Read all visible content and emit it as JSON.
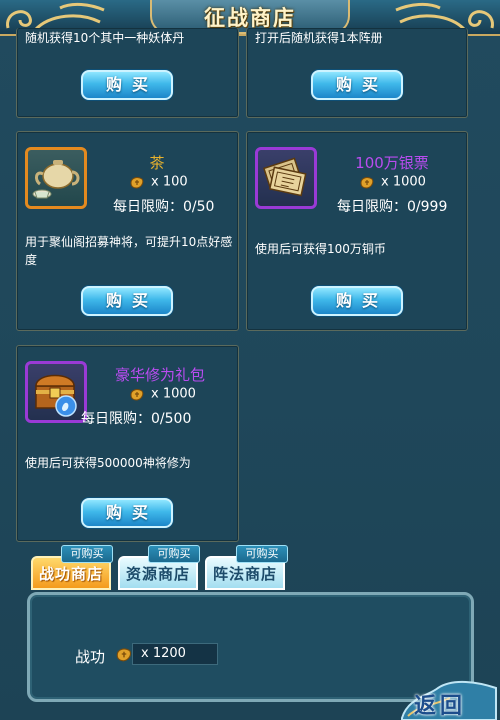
{
  "title": "征战商店",
  "top_cards": [
    {
      "desc_partial": "随机获得10个其中一种妖体丹",
      "buy_label": "购买"
    },
    {
      "desc_partial": "打开后随机获得1本阵册",
      "buy_label": "购买"
    }
  ],
  "items": [
    {
      "name": "茶",
      "name_color": "#e8b22d",
      "price": "x 100",
      "limit": "每日限购：0/50",
      "desc": "用于聚仙阁招募神将，可提升10点好感度",
      "buy_label": "购买",
      "icon": "teapot-icon"
    },
    {
      "name": "100万银票",
      "name_color": "#b94cf0",
      "price": "x 1000",
      "limit": "每日限购：0/999",
      "desc": "使用后可获得100万铜币",
      "buy_label": "购买",
      "icon": "banknote-icon"
    },
    {
      "name": "豪华修为礼包",
      "name_color": "#b94cf0",
      "price": "x 1000",
      "limit": "每日限购：0/500",
      "desc": "使用后可获得500000神将修为",
      "buy_label": "购买",
      "icon": "treasure-chest-icon"
    }
  ],
  "tabs": [
    {
      "label": "战功商店",
      "badge": "可购买",
      "active": true
    },
    {
      "label": "资源商店",
      "badge": "可购买",
      "active": false
    },
    {
      "label": "阵法商店",
      "badge": "可购买",
      "active": false
    }
  ],
  "currency": {
    "label": "战功",
    "value": "x 1200",
    "icon": "merit-coin-icon"
  },
  "back_label": "返回",
  "colors": {
    "gold": "#e8b22d",
    "purple": "#b94cf0",
    "panel": "#1d4558",
    "button": "#3fb8ea",
    "active_tab": "#f49b1c"
  }
}
